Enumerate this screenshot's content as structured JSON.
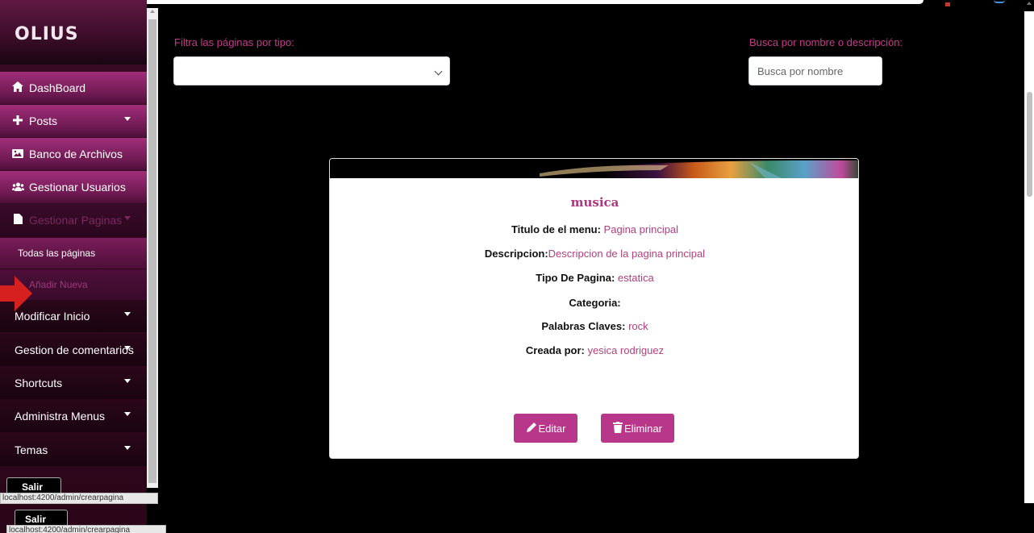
{
  "brand": {
    "name": "OLIUS"
  },
  "sidebar": {
    "items": [
      {
        "label": "DashBoard",
        "icon": "home-icon"
      },
      {
        "label": "Posts",
        "icon": "plus-icon"
      },
      {
        "label": "Banco de Archivos",
        "icon": "image-icon"
      },
      {
        "label": "Gestionar Usuarios",
        "icon": "users-icon"
      },
      {
        "label": "Gestionar Paginas",
        "icon": "file-icon"
      }
    ],
    "sub_items": [
      {
        "label": "Todas las páginas"
      },
      {
        "label": "Añadir Nueva"
      }
    ],
    "lower_items": [
      {
        "label": "Modificar Inicio"
      },
      {
        "label": "Gestion de comentarios"
      },
      {
        "label": "Shortcuts"
      },
      {
        "label": "Administra Menus"
      },
      {
        "label": "Temas"
      }
    ],
    "salir_label": "Salir",
    "status_url": "localhost:4200/admin/crearpagina"
  },
  "filters": {
    "type_label": "Filtra las páginas por tipo:",
    "type_selected": "",
    "search_label": "Busca por nombre o descripción:",
    "search_placeholder": "Busca por nombre",
    "search_value": ""
  },
  "card": {
    "title": "musica",
    "fields": [
      {
        "label": "Titulo de el menu:",
        "value": " Pagina principal"
      },
      {
        "label": "Descripcion:",
        "value": "Descripcion de la pagina principal"
      },
      {
        "label": "Tipo De Pagina:",
        "value": " estatica"
      },
      {
        "label": "Categoria:",
        "value": ""
      },
      {
        "label": "Palabras Claves:",
        "value": " rock"
      },
      {
        "label": "Creada por:",
        "value": " yesica rodriguez"
      }
    ],
    "edit_label": "Editar",
    "delete_label": "Eliminar"
  },
  "colors": {
    "accent": "#b8378a",
    "label_pink": "#c93a8a",
    "sidebar_magenta": "#a02e78"
  }
}
